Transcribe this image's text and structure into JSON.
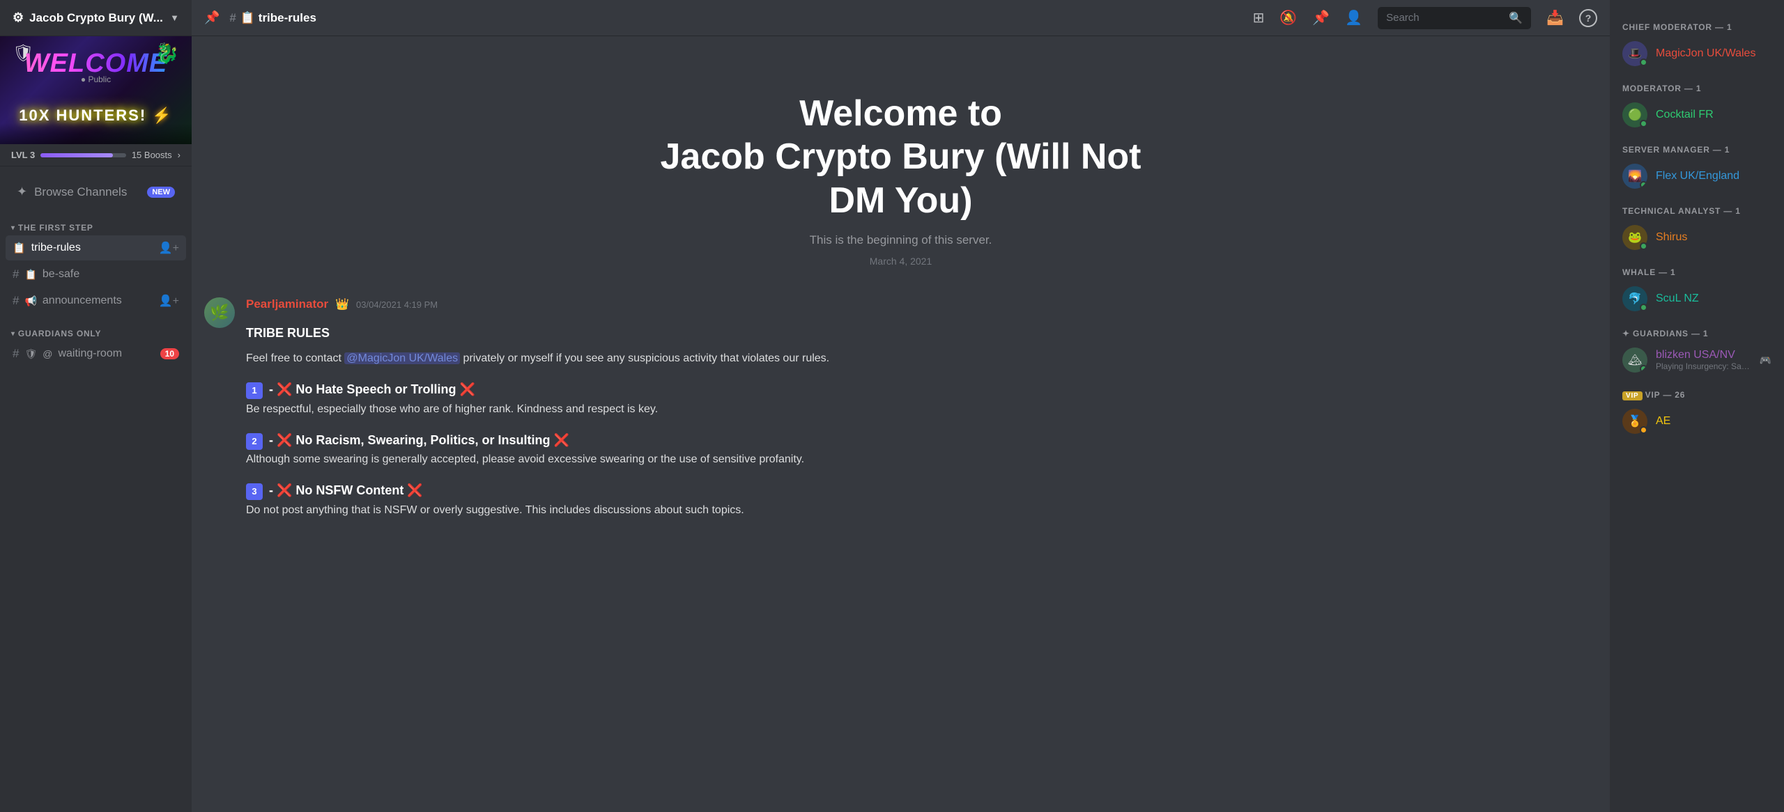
{
  "server": {
    "name": "Jacob Crypto Bury (W...",
    "visibility": "Public",
    "level": "LVL 3",
    "boosts": "15 Boosts",
    "progress": 85,
    "banner_welcome": "WELCOME",
    "banner_subtitle": "10X HUNTERS!",
    "banner_bolt": "⚡"
  },
  "sidebar": {
    "browse_channels": "Browse Channels",
    "browse_badge": "NEW",
    "sections": [
      {
        "label": "THE FIRST STEP",
        "channels": [
          {
            "type": "rules",
            "prefix": "📋",
            "name": "tribe-rules",
            "active": true,
            "add_user": true
          },
          {
            "type": "hash",
            "prefix": "📋",
            "name": "be-safe",
            "active": false,
            "add_user": false
          },
          {
            "type": "hash",
            "prefix": "📢",
            "name": "announcements",
            "active": false,
            "add_user": true
          }
        ]
      },
      {
        "label": "GUARDIANS ONLY",
        "channels": [
          {
            "type": "hash",
            "prefix": "🛡",
            "name": "waiting-room",
            "active": false,
            "badge": "10"
          }
        ]
      }
    ]
  },
  "header": {
    "channel_name": "📋 tribe-rules",
    "pin_icon": "📌",
    "search_placeholder": "Search",
    "toolbar_icons": [
      "hashtag",
      "bell-slash",
      "bell-alert",
      "person",
      "search",
      "inbox",
      "help"
    ]
  },
  "welcome": {
    "line1": "Welcome to",
    "line2": "Jacob Crypto Bury (Will Not",
    "line3": "DM You)",
    "subtitle": "This is the beginning of this server.",
    "date": "March 4, 2021"
  },
  "message": {
    "author": "Pearljaminator",
    "author_icon": "👑",
    "timestamp": "03/04/2021 4:19 PM",
    "title": "TRIBE RULES",
    "intro": "Feel free to contact @MagicJon UK/Wales privately or myself if you see any suspicious activity that violates our rules.",
    "mention": "@MagicJon UK/Wales",
    "rules": [
      {
        "num": "1",
        "icon": "❌",
        "title": "No Hate Speech or Trolling",
        "icon2": "❌",
        "body": "Be respectful, especially those who are of higher rank. Kindness and respect is key."
      },
      {
        "num": "2",
        "icon": "❌",
        "title": "No Racism, Swearing, Politics, or Insulting",
        "icon2": "❌",
        "body": "Although some swearing is generally accepted, please avoid excessive swearing or the use of sensitive profanity."
      },
      {
        "num": "3",
        "icon": "❌",
        "title": "No NSFW Content",
        "icon2": "❌",
        "body": "Do not post anything that is NSFW or overly suggestive. This includes discussions about such topics."
      }
    ]
  },
  "members": {
    "groups": [
      {
        "role": "CHIEF MODERATOR — 1",
        "members": [
          {
            "name": "MagicJon UK/Wales",
            "color": "chief",
            "status": "online",
            "emoji": "🎩"
          }
        ]
      },
      {
        "role": "MODERATOR — 1",
        "members": [
          {
            "name": "Cocktail FR",
            "color": "mod",
            "status": "online",
            "emoji": "🟢"
          }
        ]
      },
      {
        "role": "SERVER MANAGER — 1",
        "members": [
          {
            "name": "Flex UK/England",
            "color": "manager",
            "status": "online",
            "emoji": "🌄"
          }
        ]
      },
      {
        "role": "TECHNICAL ANALYST — 1",
        "members": [
          {
            "name": "Shirus",
            "color": "analyst",
            "status": "online",
            "emoji": "🐸"
          }
        ]
      },
      {
        "role": "WHALE — 1",
        "members": [
          {
            "name": "ScuL NZ",
            "color": "whale",
            "status": "online",
            "emoji": "🐬"
          }
        ]
      },
      {
        "role": "GUARDIANS — 1",
        "members": [
          {
            "name": "blizken USA/NV",
            "color": "guardian",
            "status": "online",
            "emoji": "🏔",
            "sub": "Playing Insurgency: Sands..."
          }
        ]
      },
      {
        "role": "VIP — 26",
        "members": [
          {
            "name": "AE",
            "color": "vip",
            "status": "online",
            "emoji": "🏅"
          }
        ]
      }
    ]
  }
}
